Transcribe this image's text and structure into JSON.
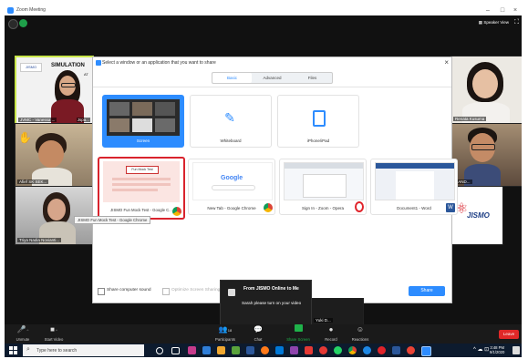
{
  "window": {
    "title": "Zoom Meeting",
    "minimize": "–",
    "maximize": "□"
  },
  "header": {
    "speaker_view": "Speaker View",
    "fullscreen_icon": "fullscreen-icon"
  },
  "participants": [
    {
      "name": "JVMC - Vanessa ...",
      "suffix": "Jspa...",
      "slide_text": "SIMULATION",
      "slide_sub": "AT",
      "slide_logo": "JISMO"
    },
    {
      "name": "Afief SK SEK..."
    },
    {
      "name": "Triya Nadia Novianti..."
    },
    {
      "name": "Renata Kusuma"
    },
    {
      "name": "NAND..."
    },
    {
      "name": "JISMO"
    },
    {
      "name": "Yuki D..."
    }
  ],
  "dialog": {
    "title": "Select a window or an application that you want to share",
    "close": "×",
    "tabs": [
      {
        "label": "Basic"
      },
      {
        "label": "Advanced"
      },
      {
        "label": "Files"
      }
    ],
    "cards": [
      {
        "label": "Screen"
      },
      {
        "label": "Whiteboard"
      },
      {
        "label": "iPhone/iPad"
      },
      {
        "label": "JISMO Fun Mock Test - Google C...",
        "thumb_text": "Fun Mock Test"
      },
      {
        "label": "New Tab - Google Chrome",
        "thumb_text": "Google"
      },
      {
        "label": "Sign In - Zoom - Opera"
      },
      {
        "label": "Document1 - Word"
      }
    ],
    "tooltip": "JISMO Fun Mock Test - Google Chrome",
    "share_sound": "Share computer sound",
    "optimize": "Optimize Screen Sharing for Video Clip",
    "share_button": "Share"
  },
  "toast": {
    "title": "From JISMO Online to Me",
    "body": "Sarah please turn on your video"
  },
  "controls": {
    "unmute": "Unmute",
    "start_video": "Start Video",
    "participants": "Participants",
    "participants_count": "18",
    "chat": "Chat",
    "chat_badge": "",
    "share_screen": "Share Screen",
    "record": "Record",
    "reactions": "Reactions",
    "leave": "Leave"
  },
  "taskbar": {
    "search_placeholder": "Type here to search",
    "time": "3:48 PM",
    "date": "9/1/2020"
  },
  "colors": {
    "zoom_blue": "#2d8cff",
    "leave_red": "#e02828",
    "highlight_red": "#d9232d"
  }
}
